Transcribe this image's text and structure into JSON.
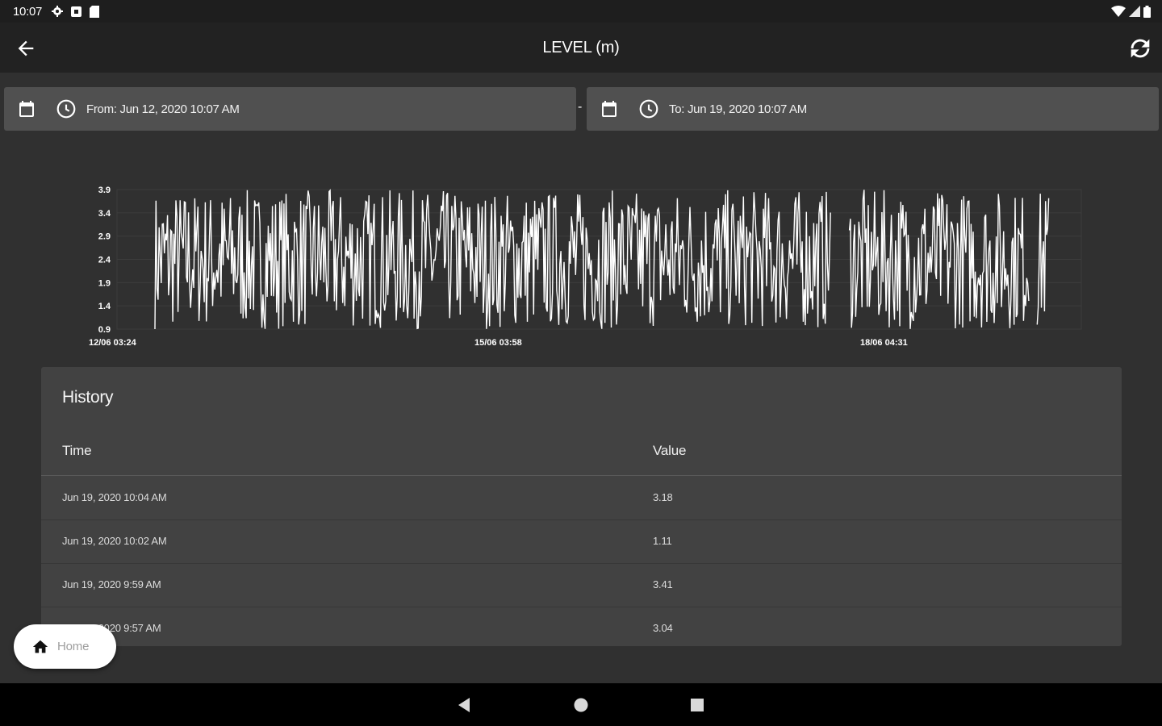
{
  "status_bar": {
    "time": "10:07",
    "icons": [
      "gear-icon",
      "sim-icon",
      "sd-card-icon"
    ],
    "right_icons": [
      "wifi-icon",
      "signal-icon",
      "battery-icon"
    ]
  },
  "app_bar": {
    "title": "LEVEL (m)"
  },
  "date_range": {
    "from": "From: Jun 12, 2020 10:07 AM",
    "separator": "-",
    "to": "To: Jun 19, 2020 10:07 AM"
  },
  "chart_data": {
    "type": "line",
    "title": "",
    "xlabel": "",
    "ylabel": "",
    "y_ticks": [
      "3.9",
      "3.4",
      "2.9",
      "2.4",
      "1.9",
      "1.4",
      "0.9"
    ],
    "x_ticks": [
      "12/06 03:24",
      "15/06 03:58",
      "18/06 04:31"
    ],
    "ylim": [
      0.9,
      3.9
    ],
    "grid": true,
    "legend": "none",
    "series": [
      {
        "description_values_note": "",
        "min": 0.9,
        "max": 3.9
      }
    ],
    "line_color": "#ffffff"
  },
  "history": {
    "title": "History",
    "columns": [
      "Time",
      "Value"
    ],
    "rows": [
      {
        "time": "Jun 19, 2020 10:04 AM",
        "value": "3.18"
      },
      {
        "time": "Jun 19, 2020 10:02 AM",
        "value": "1.11"
      },
      {
        "time": "Jun 19, 2020 9:59 AM",
        "value": "3.41"
      },
      {
        "time": "Jun 19, 2020 9:57 AM",
        "value": "3.04"
      }
    ]
  },
  "fab": {
    "label": "Home"
  },
  "nav_bar": {
    "buttons": [
      "back-triangle-icon",
      "home-circle-icon",
      "recents-square-icon"
    ]
  }
}
